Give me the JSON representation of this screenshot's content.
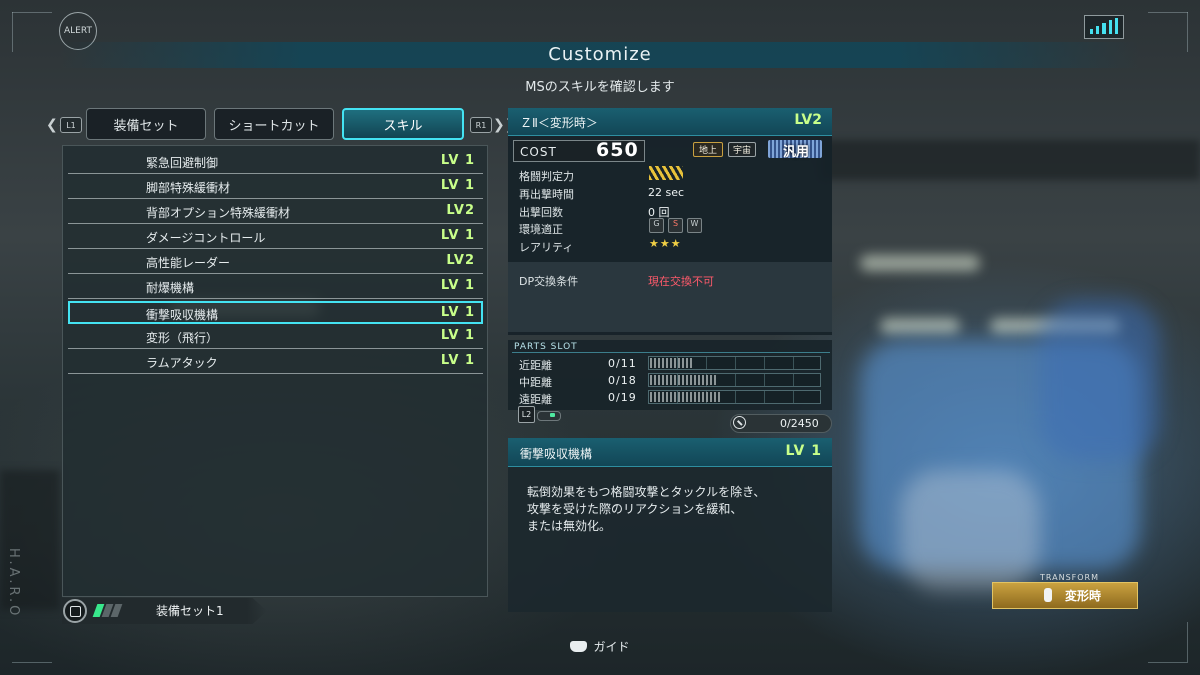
{
  "header": {
    "alert_label": "ALERT",
    "title": "Customize",
    "subtitle": "MSのスキルを確認します"
  },
  "tabs": {
    "left_button": "L1",
    "right_button": "R1",
    "items": [
      {
        "label": "装備セット",
        "active": false
      },
      {
        "label": "ショートカット",
        "active": false
      },
      {
        "label": "スキル",
        "active": true
      }
    ]
  },
  "skills": [
    {
      "name": "緊急回避制御",
      "level": "LV 1"
    },
    {
      "name": "脚部特殊緩衝材",
      "level": "LV 1"
    },
    {
      "name": "背部オプション特殊緩衝材",
      "level": "LV2"
    },
    {
      "name": "ダメージコントロール",
      "level": "LV 1"
    },
    {
      "name": "高性能レーダー",
      "level": "LV2"
    },
    {
      "name": "耐爆機構",
      "level": "LV 1"
    },
    {
      "name": "衝撃吸収機構",
      "level": "LV 1"
    },
    {
      "name": "変形（飛行）",
      "level": "LV 1"
    },
    {
      "name": "ラムアタック",
      "level": "LV 1"
    }
  ],
  "selected_skill_index": 6,
  "loadout": {
    "label": "装備セット1",
    "segments_filled": 1,
    "segments_total": 3
  },
  "ms": {
    "name": "ＺⅡ＜変形時＞",
    "level": "LV2",
    "cost_label": "COST",
    "cost": "650",
    "terrain_ground": "地上",
    "terrain_space": "宇宙",
    "type": "汎用",
    "stats": [
      {
        "label": "格闘判定力",
        "value": ""
      },
      {
        "label": "再出撃時間",
        "value": "22 sec"
      },
      {
        "label": "出撃回数",
        "value": "0 回"
      },
      {
        "label": "環境適正",
        "value": ""
      },
      {
        "label": "レアリティ",
        "value": "★★★"
      }
    ],
    "environment_icons": [
      "G",
      "S",
      "W"
    ],
    "dp_label": "DP交換条件",
    "dp_value": "現在交換不可"
  },
  "parts_slot": {
    "header": "PARTS SLOT",
    "rows": [
      {
        "label": "近距離",
        "value": "0/11",
        "slots": 11
      },
      {
        "label": "中距離",
        "value": "0/18",
        "slots": 18
      },
      {
        "label": "遠距離",
        "value": "0/19",
        "slots": 19
      }
    ],
    "l2_button": "L2",
    "capacity": "0/2450"
  },
  "description": {
    "name": "衝撃吸収機構",
    "level": "LV 1",
    "line1": "転倒効果をもつ格闘攻撃とタックルを除き、",
    "line2": "攻撃を受けた際のリアクションを緩和、",
    "line3": "または無効化。"
  },
  "transform": {
    "caption": "TRANSFORM",
    "label": "変形時"
  },
  "guide": {
    "label": "ガイド"
  },
  "colors": {
    "accent_cyan": "#44e3f2",
    "level_green": "#c8ff8a",
    "warning_red": "#ff5a6b",
    "transform_gold": "#caa240"
  }
}
